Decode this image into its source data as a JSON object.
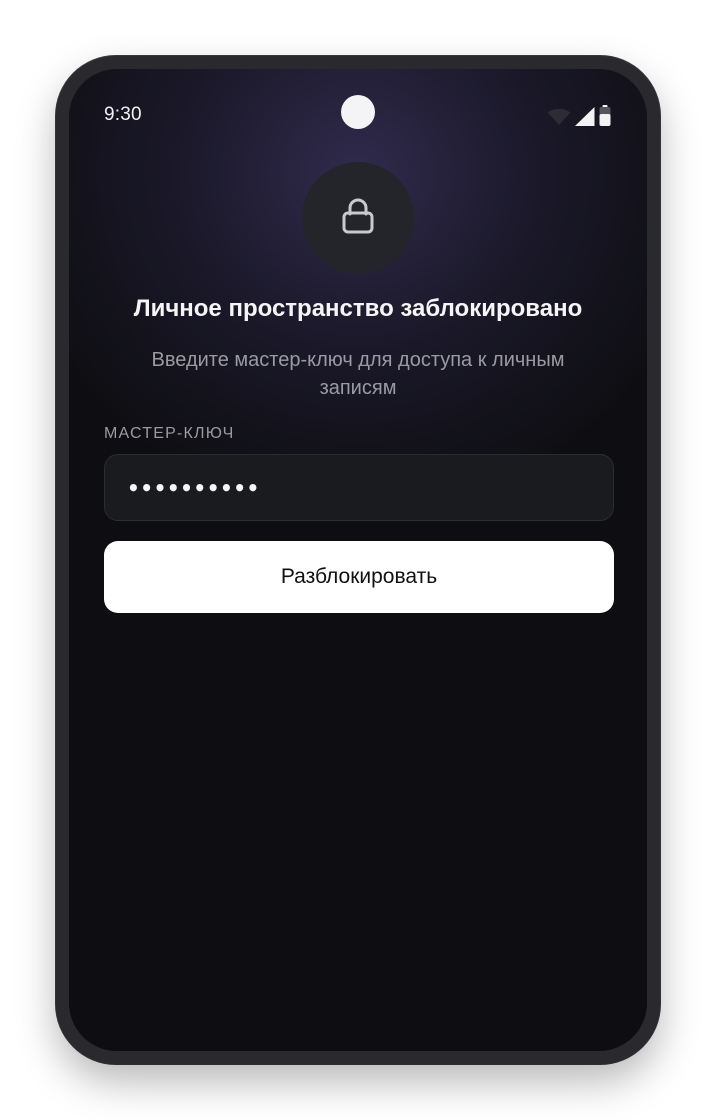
{
  "status_bar": {
    "time": "9:30",
    "icons": [
      "wifi-icon",
      "cellular-signal-icon",
      "battery-icon"
    ]
  },
  "lock_screen": {
    "icon": "lock-icon",
    "title": "Личное пространство заблокировано",
    "subtitle": "Введите мастер-ключ для доступа к личным записям",
    "field_label": "МАСТЕР-КЛЮЧ",
    "master_key_value": "••••••••••",
    "unlock_button_label": "Разблокировать"
  },
  "colors": {
    "background": "#0e0e12",
    "glow": "#3c3460",
    "input_background": "#1a1b1f",
    "button_background": "#ffffff",
    "button_text": "#111114",
    "muted_text": "#9a9aa3",
    "primary_text": "#f5f5f7"
  }
}
